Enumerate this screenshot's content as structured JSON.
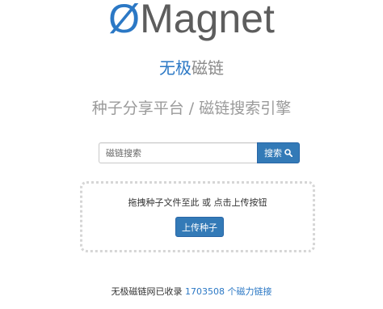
{
  "logo": {
    "symbol": "Ø",
    "text": "Magnet"
  },
  "subtitle": {
    "part1": "无极",
    "part2": "磁链"
  },
  "tagline": "种子分享平台 / 磁链搜索引擎",
  "search": {
    "placeholder": "磁链搜索",
    "button_label": "搜索"
  },
  "upload": {
    "instruction": "拖拽种子文件至此 或 点击上传按钮",
    "button_label": "上传种子"
  },
  "footer": {
    "prefix": "无极磁链网已收录 ",
    "count": "1703508",
    "link_text": " 个磁力链接"
  },
  "colors": {
    "accent": "#2b78c5",
    "button": "#337ab7"
  },
  "icons": {
    "search_button": "search-icon"
  }
}
